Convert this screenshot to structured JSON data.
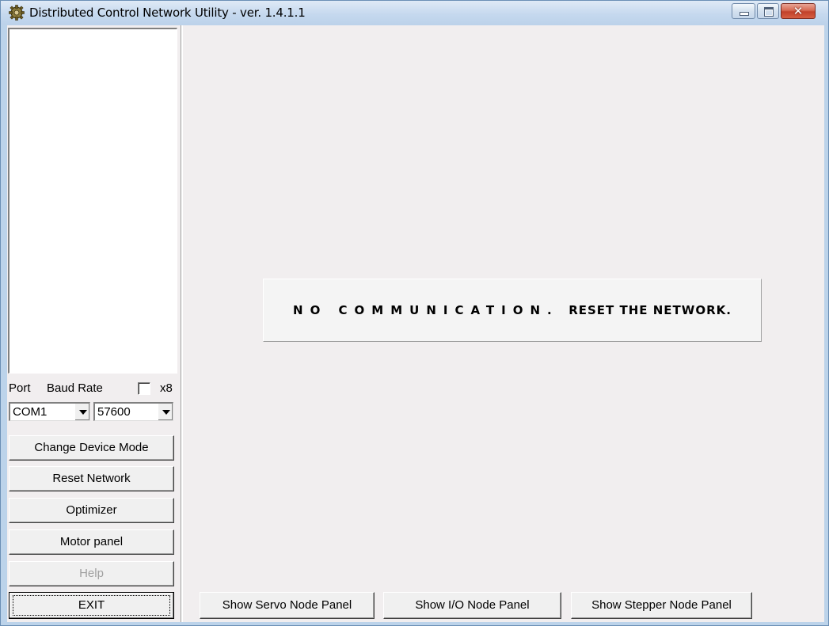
{
  "window": {
    "title": "Distributed Control Network Utility - ver. 1.4.1.1",
    "close_glyph": "✕"
  },
  "sidebar": {
    "port_label": "Port",
    "baud_rate_label": "Baud Rate",
    "x8_label": "x8",
    "x8_checked": false,
    "port_value": "COM1",
    "baud_value": "57600",
    "buttons": {
      "change_device_mode": "Change Device Mode",
      "reset_network": "Reset Network",
      "optimizer": "Optimizer",
      "motor_panel": "Motor panel",
      "help": "Help",
      "exit": "EXIT"
    }
  },
  "main": {
    "message_part1": "NO COMMUNICATION.",
    "message_part2": "RESET THE NETWORK.",
    "bottom_buttons": {
      "servo": "Show Servo Node Panel",
      "io": "Show I/O Node Panel",
      "stepper": "Show Stepper Node Panel"
    }
  },
  "icons": {
    "app": "gear-icon",
    "minimize": "minimize-icon",
    "maximize": "maximize-icon",
    "close": "close-icon",
    "dropdown": "chevron-down-icon"
  }
}
